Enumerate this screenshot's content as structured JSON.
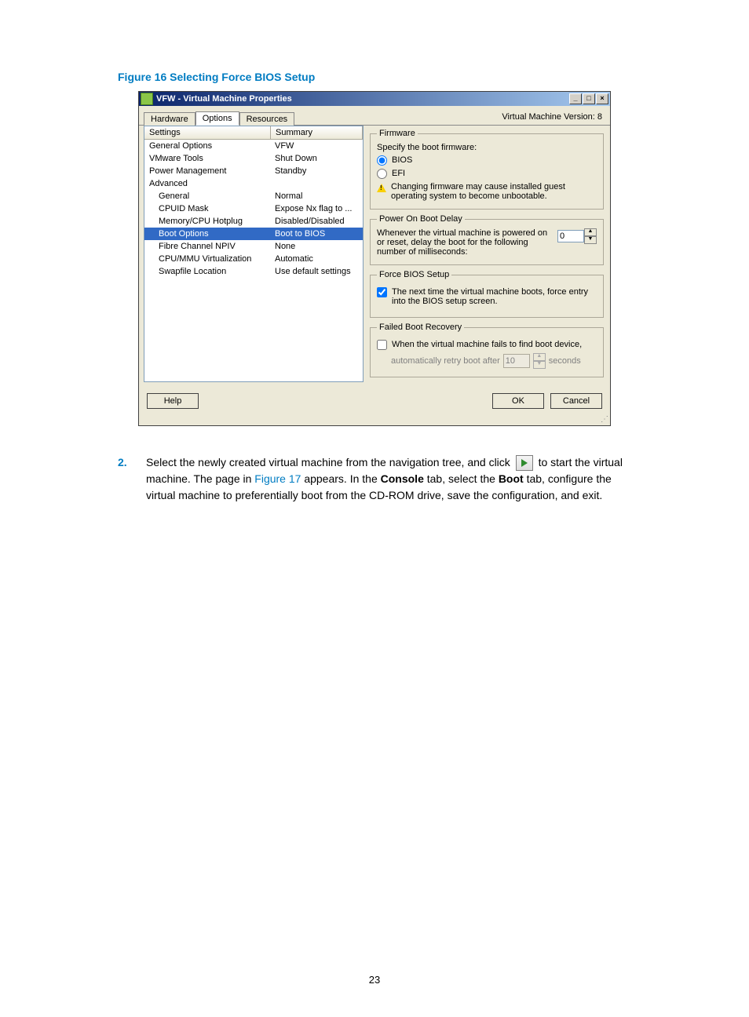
{
  "figure_caption": "Figure 16 Selecting Force BIOS Setup",
  "window": {
    "title": "VFW - Virtual Machine Properties",
    "min": "_",
    "max": "□",
    "close": "×",
    "tabs": {
      "hardware": "Hardware",
      "options": "Options",
      "resources": "Resources"
    },
    "vm_version": "Virtual Machine Version: 8"
  },
  "table": {
    "headers": {
      "settings": "Settings",
      "summary": "Summary"
    },
    "rows": [
      {
        "setting": "General Options",
        "summary": "VFW",
        "indent": false
      },
      {
        "setting": "VMware Tools",
        "summary": "Shut Down",
        "indent": false
      },
      {
        "setting": "Power Management",
        "summary": "Standby",
        "indent": false
      },
      {
        "setting": "Advanced",
        "summary": "",
        "indent": false
      },
      {
        "setting": "General",
        "summary": "Normal",
        "indent": true
      },
      {
        "setting": "CPUID Mask",
        "summary": "Expose Nx flag to ...",
        "indent": true
      },
      {
        "setting": "Memory/CPU Hotplug",
        "summary": "Disabled/Disabled",
        "indent": true
      },
      {
        "setting": "Boot Options",
        "summary": "Boot to BIOS",
        "indent": true,
        "selected": true
      },
      {
        "setting": "Fibre Channel NPIV",
        "summary": "None",
        "indent": true
      },
      {
        "setting": "CPU/MMU Virtualization",
        "summary": "Automatic",
        "indent": true
      },
      {
        "setting": "Swapfile Location",
        "summary": "Use default settings",
        "indent": true
      }
    ]
  },
  "firmware": {
    "legend": "Firmware",
    "label": "Specify the boot firmware:",
    "bios": "BIOS",
    "efi": "EFI",
    "warning": "Changing firmware may cause installed guest operating system to become unbootable."
  },
  "poweron": {
    "legend": "Power On Boot Delay",
    "text": "Whenever the virtual machine is powered on or reset, delay the boot for the following number of milliseconds:",
    "value": "0"
  },
  "forcebios": {
    "legend": "Force BIOS Setup",
    "text": "The next time the virtual machine boots, force entry into the BIOS setup screen."
  },
  "failed": {
    "legend": "Failed Boot Recovery",
    "text": "When the virtual machine fails to find boot device,",
    "retry_prefix": "automatically retry boot after",
    "retry_value": "10",
    "retry_suffix": "seconds"
  },
  "buttons": {
    "help": "Help",
    "ok": "OK",
    "cancel": "Cancel"
  },
  "step": {
    "num": "2.",
    "p1": "Select the newly created virtual machine from the navigation tree, and click ",
    "p2": " to start the virtual machine. The page in ",
    "link": "Figure 17",
    "p3": " appears. In the ",
    "b1": "Console",
    "p4": " tab, select the ",
    "b2": "Boot",
    "p5": " tab, configure the virtual machine to preferentially boot from the CD-ROM drive, save the configuration, and exit."
  },
  "page_number": "23"
}
